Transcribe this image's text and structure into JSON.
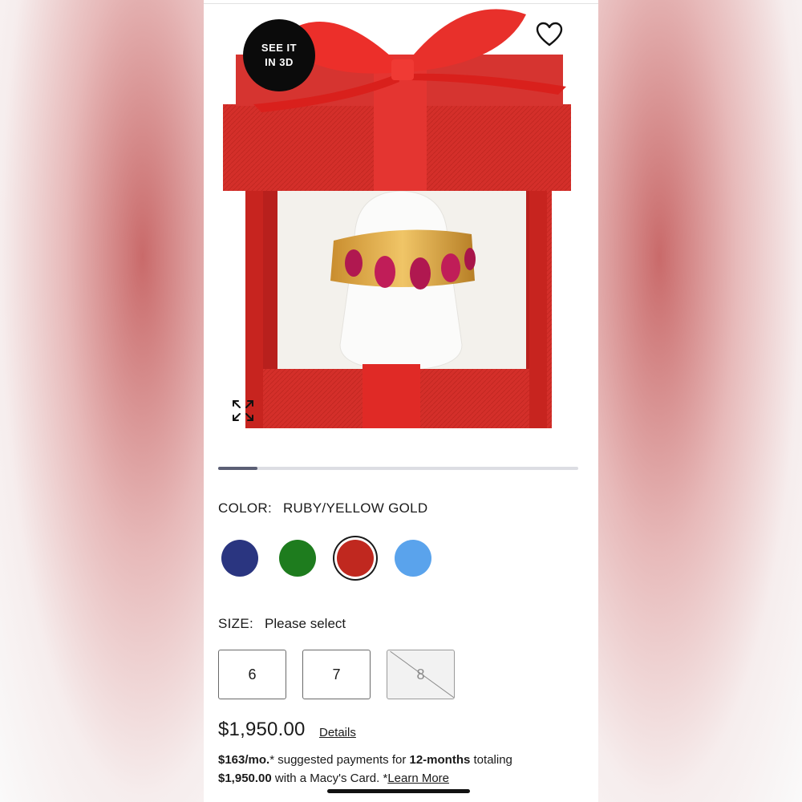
{
  "badge": {
    "see_3d": "SEE IT\nIN 3D"
  },
  "icons": {
    "favorite": "heart-outline-icon",
    "expand": "expand-arrows-icon"
  },
  "carousel": {
    "progress": 0.11
  },
  "color": {
    "label": "COLOR:",
    "selected": "RUBY/YELLOW GOLD",
    "options": [
      {
        "hex": "#2a3580",
        "selected": false
      },
      {
        "hex": "#1e7c1e",
        "selected": false
      },
      {
        "hex": "#c0281f",
        "selected": true
      },
      {
        "hex": "#5aa3ec",
        "selected": false
      }
    ]
  },
  "size": {
    "label": "SIZE:",
    "prompt": "Please select",
    "options": [
      {
        "label": "6",
        "available": true
      },
      {
        "label": "7",
        "available": true
      },
      {
        "label": "8",
        "available": false
      }
    ]
  },
  "price": {
    "amount": "$1,950.00",
    "details_link": "Details"
  },
  "financing": {
    "monthly": "$163/mo.",
    "asterisk": "*",
    "text1": " suggested payments for ",
    "term": "12-months",
    "text2": " totaling",
    "total": "$1,950.00",
    "text3": " with a Macy's Card. *",
    "learn_more": "Learn More"
  },
  "colors": {
    "box_red": "#d42f2a",
    "ribbon": "#e22525",
    "cushion": "#f3f1ec",
    "gold": "#d9a541",
    "ruby": "#b01850"
  }
}
